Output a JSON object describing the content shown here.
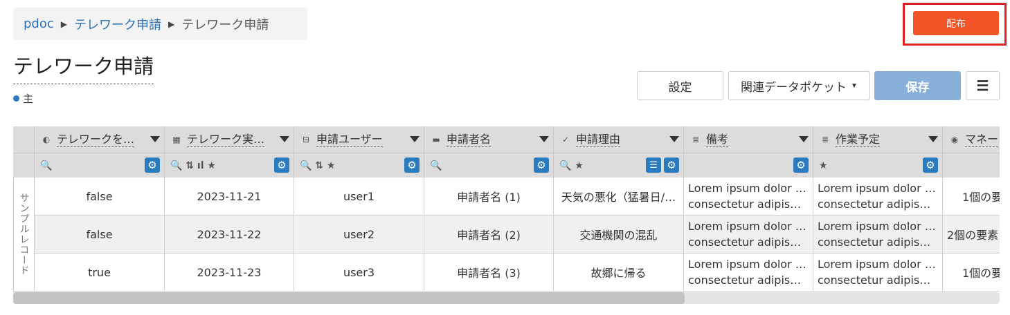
{
  "breadcrumb": {
    "root": "pdoc",
    "parent": "テレワーク申請",
    "current": "テレワーク申請"
  },
  "distribute_label": "配布",
  "page": {
    "title": "テレワーク申請",
    "tag": "主"
  },
  "toolbar": {
    "settings": "設定",
    "related": "関連データポケット",
    "save": "保存",
    "menu": "☰"
  },
  "colors": {
    "accent": "#2a7abf",
    "distribute": "#f25427",
    "save": "#87afd8",
    "highlight": "#e02020"
  },
  "columns": [
    {
      "title": "テレワークを…",
      "icon": "toggle-icon",
      "tools": "🔍"
    },
    {
      "title": "テレワーク実…",
      "icon": "calendar-icon",
      "tools": "🔍 ⇅ ıl ★"
    },
    {
      "title": "申請ユーザー",
      "icon": "user-field-icon",
      "tools": "🔍 ⇅ ★"
    },
    {
      "title": "申請者名",
      "icon": "text-field-icon",
      "tools": "🔍"
    },
    {
      "title": "申請理由",
      "icon": "select-field-icon",
      "tools": "🔍 ★"
    },
    {
      "title": "備考",
      "icon": "document-icon",
      "tools": ""
    },
    {
      "title": "作業予定",
      "icon": "document-icon",
      "tools": "★"
    },
    {
      "title": "マネー",
      "icon": "money-icon",
      "tools": ""
    }
  ],
  "row_group_label": "サンプルレコード",
  "rows": [
    [
      "false",
      "2023-11-21",
      "user1",
      "申請者名 (1)",
      "天気の悪化（猛暑日/…",
      "Lorem ipsum dolor …",
      "consectetur adipisci…",
      "Lorem ipsum dolor …",
      "consectetur adipisci…",
      "1個の要"
    ],
    [
      "false",
      "2023-11-22",
      "user2",
      "申請者名 (2)",
      "交通機関の混乱",
      "Lorem ipsum dolor …",
      "consectetur adipisci…",
      "Lorem ipsum dolor …",
      "consectetur adipisci…",
      "2個の要素"
    ],
    [
      "true",
      "2023-11-23",
      "user3",
      "申請者名 (3)",
      "故郷に帰る",
      "Lorem ipsum dolor …",
      "consectetur adipisci…",
      "Lorem ipsum dolor …",
      "consectetur adipisci…",
      "1個の要"
    ]
  ]
}
